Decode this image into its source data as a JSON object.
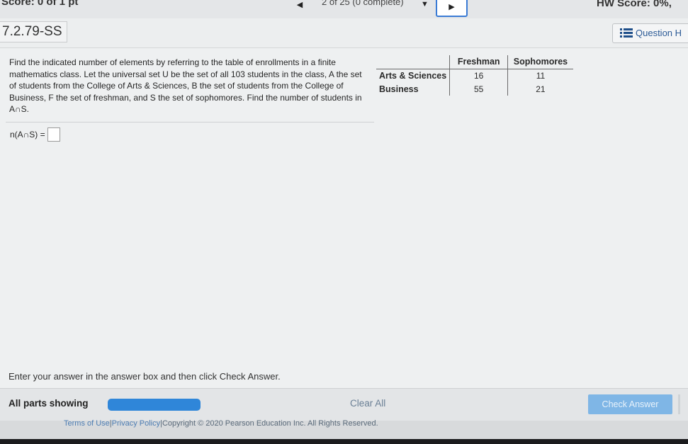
{
  "topbar": {
    "score_partial": "Score: 0 of 1 pt",
    "prev_symbol": "◀",
    "progress": "2 of 25 (0 complete)",
    "dropdown_symbol": "▼",
    "next_symbol": "▶",
    "hw_score": "HW Score: 0%,"
  },
  "header": {
    "problem_id": "7.2.79-SS",
    "question_help_label": "Question H"
  },
  "question": {
    "text": "Find the indicated number of elements by referring to the table of enrollments in a finite mathematics class. Let the universal set U be the set of all 103 students in the class, A the set of students from the College of Arts & Sciences, B the set of students from the College of Business, F the set of freshman, and S the set of sophomores. Find the number of students in A∩S.",
    "table": {
      "columns": [
        "Freshman",
        "Sophomores"
      ],
      "rows": [
        {
          "label": "Arts & Sciences",
          "values": [
            "16",
            "11"
          ]
        },
        {
          "label": "Business",
          "values": [
            "55",
            "21"
          ]
        }
      ]
    },
    "answer_label": "n(A∩S) ="
  },
  "instruction": "Enter your answer in the answer box and then click Check Answer.",
  "bottom": {
    "parts_label": "All parts showing",
    "clear_all": "Clear All",
    "check_answer": "Check Answer"
  },
  "footer": {
    "terms": "Terms of Use",
    "privacy": "Privacy Policy",
    "copyright": "Copyright © 2020 Pearson Education Inc. All Rights Reserved."
  },
  "colors": {
    "accent": "#2f86d9",
    "check_button": "#7fb6e6",
    "link": "#2b5a96"
  }
}
